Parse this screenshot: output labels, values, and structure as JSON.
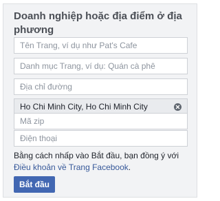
{
  "form": {
    "title": "Doanh nghiệp hoặc địa điểm ở địa phương",
    "fields": {
      "page_name": {
        "value": "",
        "placeholder": "Tên Trang, ví dụ như Pat's Cafe"
      },
      "category": {
        "value": "",
        "placeholder": "Danh mục Trang, ví dụ: Quán cà phê"
      },
      "address": {
        "value": "",
        "placeholder": "Địa chỉ đường"
      },
      "city": {
        "value": "Ho Chi Minh City, Ho Chi Minh City",
        "placeholder": ""
      },
      "zip": {
        "value": "",
        "placeholder": "Mã zip"
      },
      "phone": {
        "value": "",
        "placeholder": "Điện thoại"
      }
    },
    "agreement": {
      "text_before": "Bằng cách nhấp vào Bắt đầu, bạn đồng ý với ",
      "link_text": "Điều khoản về Trang Facebook",
      "text_after": "."
    },
    "start_button": "Bắt đầu"
  },
  "colors": {
    "panel_bg": "#f2f3f5",
    "title": "#4b4f56",
    "link": "#365899",
    "button": "#4267b2"
  }
}
